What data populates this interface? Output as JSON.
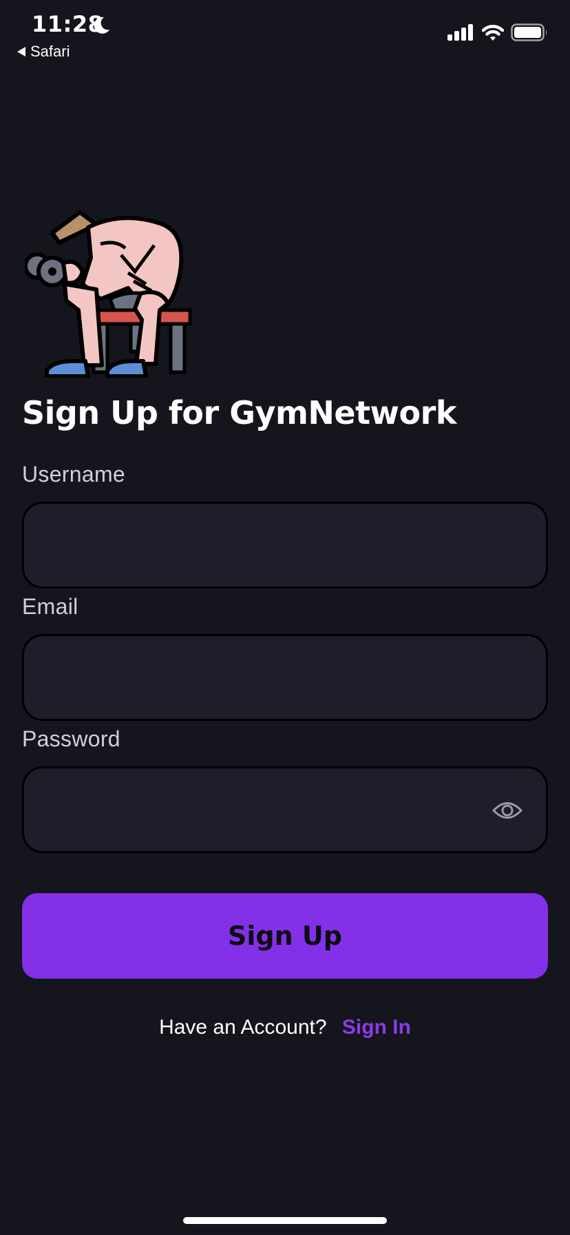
{
  "status_bar": {
    "time": "11:28",
    "back_app": "Safari"
  },
  "page": {
    "title": "Sign Up for GymNetwork"
  },
  "form": {
    "username_label": "Username",
    "username_value": "",
    "email_label": "Email",
    "email_value": "",
    "password_label": "Password",
    "password_value": "",
    "submit_label": "Sign Up"
  },
  "footer": {
    "prompt": "Have an Account?",
    "link": "Sign In"
  },
  "icons": {
    "mascot": "bodybuilder-dumbbell-icon",
    "password_toggle": "eye-icon"
  },
  "colors": {
    "background": "#15151e",
    "field_background": "#1e1e2b",
    "accent": "#8430e8",
    "link": "#8b3ce6"
  }
}
